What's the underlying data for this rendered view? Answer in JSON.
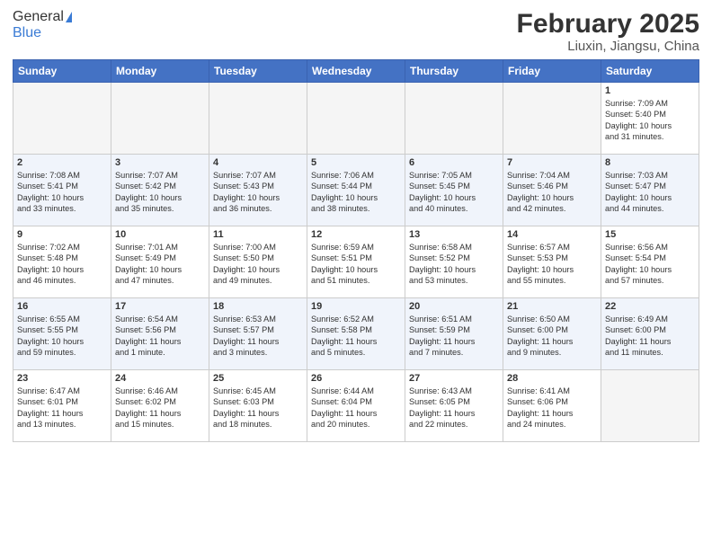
{
  "header": {
    "logo_line1": "General",
    "logo_line2": "Blue",
    "title": "February 2025",
    "subtitle": "Liuxin, Jiangsu, China"
  },
  "days_of_week": [
    "Sunday",
    "Monday",
    "Tuesday",
    "Wednesday",
    "Thursday",
    "Friday",
    "Saturday"
  ],
  "weeks": [
    {
      "shade": false,
      "days": [
        {
          "num": "",
          "info": ""
        },
        {
          "num": "",
          "info": ""
        },
        {
          "num": "",
          "info": ""
        },
        {
          "num": "",
          "info": ""
        },
        {
          "num": "",
          "info": ""
        },
        {
          "num": "",
          "info": ""
        },
        {
          "num": "1",
          "info": "Sunrise: 7:09 AM\nSunset: 5:40 PM\nDaylight: 10 hours\nand 31 minutes."
        }
      ]
    },
    {
      "shade": true,
      "days": [
        {
          "num": "2",
          "info": "Sunrise: 7:08 AM\nSunset: 5:41 PM\nDaylight: 10 hours\nand 33 minutes."
        },
        {
          "num": "3",
          "info": "Sunrise: 7:07 AM\nSunset: 5:42 PM\nDaylight: 10 hours\nand 35 minutes."
        },
        {
          "num": "4",
          "info": "Sunrise: 7:07 AM\nSunset: 5:43 PM\nDaylight: 10 hours\nand 36 minutes."
        },
        {
          "num": "5",
          "info": "Sunrise: 7:06 AM\nSunset: 5:44 PM\nDaylight: 10 hours\nand 38 minutes."
        },
        {
          "num": "6",
          "info": "Sunrise: 7:05 AM\nSunset: 5:45 PM\nDaylight: 10 hours\nand 40 minutes."
        },
        {
          "num": "7",
          "info": "Sunrise: 7:04 AM\nSunset: 5:46 PM\nDaylight: 10 hours\nand 42 minutes."
        },
        {
          "num": "8",
          "info": "Sunrise: 7:03 AM\nSunset: 5:47 PM\nDaylight: 10 hours\nand 44 minutes."
        }
      ]
    },
    {
      "shade": false,
      "days": [
        {
          "num": "9",
          "info": "Sunrise: 7:02 AM\nSunset: 5:48 PM\nDaylight: 10 hours\nand 46 minutes."
        },
        {
          "num": "10",
          "info": "Sunrise: 7:01 AM\nSunset: 5:49 PM\nDaylight: 10 hours\nand 47 minutes."
        },
        {
          "num": "11",
          "info": "Sunrise: 7:00 AM\nSunset: 5:50 PM\nDaylight: 10 hours\nand 49 minutes."
        },
        {
          "num": "12",
          "info": "Sunrise: 6:59 AM\nSunset: 5:51 PM\nDaylight: 10 hours\nand 51 minutes."
        },
        {
          "num": "13",
          "info": "Sunrise: 6:58 AM\nSunset: 5:52 PM\nDaylight: 10 hours\nand 53 minutes."
        },
        {
          "num": "14",
          "info": "Sunrise: 6:57 AM\nSunset: 5:53 PM\nDaylight: 10 hours\nand 55 minutes."
        },
        {
          "num": "15",
          "info": "Sunrise: 6:56 AM\nSunset: 5:54 PM\nDaylight: 10 hours\nand 57 minutes."
        }
      ]
    },
    {
      "shade": true,
      "days": [
        {
          "num": "16",
          "info": "Sunrise: 6:55 AM\nSunset: 5:55 PM\nDaylight: 10 hours\nand 59 minutes."
        },
        {
          "num": "17",
          "info": "Sunrise: 6:54 AM\nSunset: 5:56 PM\nDaylight: 11 hours\nand 1 minute."
        },
        {
          "num": "18",
          "info": "Sunrise: 6:53 AM\nSunset: 5:57 PM\nDaylight: 11 hours\nand 3 minutes."
        },
        {
          "num": "19",
          "info": "Sunrise: 6:52 AM\nSunset: 5:58 PM\nDaylight: 11 hours\nand 5 minutes."
        },
        {
          "num": "20",
          "info": "Sunrise: 6:51 AM\nSunset: 5:59 PM\nDaylight: 11 hours\nand 7 minutes."
        },
        {
          "num": "21",
          "info": "Sunrise: 6:50 AM\nSunset: 6:00 PM\nDaylight: 11 hours\nand 9 minutes."
        },
        {
          "num": "22",
          "info": "Sunrise: 6:49 AM\nSunset: 6:00 PM\nDaylight: 11 hours\nand 11 minutes."
        }
      ]
    },
    {
      "shade": false,
      "days": [
        {
          "num": "23",
          "info": "Sunrise: 6:47 AM\nSunset: 6:01 PM\nDaylight: 11 hours\nand 13 minutes."
        },
        {
          "num": "24",
          "info": "Sunrise: 6:46 AM\nSunset: 6:02 PM\nDaylight: 11 hours\nand 15 minutes."
        },
        {
          "num": "25",
          "info": "Sunrise: 6:45 AM\nSunset: 6:03 PM\nDaylight: 11 hours\nand 18 minutes."
        },
        {
          "num": "26",
          "info": "Sunrise: 6:44 AM\nSunset: 6:04 PM\nDaylight: 11 hours\nand 20 minutes."
        },
        {
          "num": "27",
          "info": "Sunrise: 6:43 AM\nSunset: 6:05 PM\nDaylight: 11 hours\nand 22 minutes."
        },
        {
          "num": "28",
          "info": "Sunrise: 6:41 AM\nSunset: 6:06 PM\nDaylight: 11 hours\nand 24 minutes."
        },
        {
          "num": "",
          "info": ""
        }
      ]
    }
  ]
}
